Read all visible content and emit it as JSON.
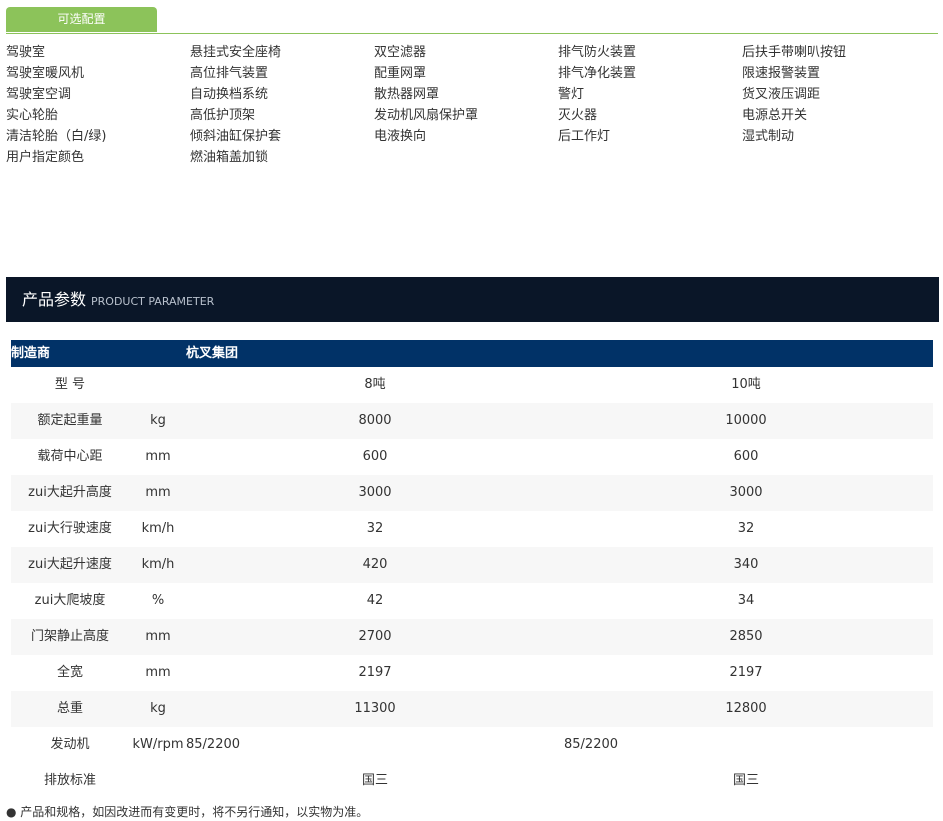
{
  "tab": {
    "label": "可选配置"
  },
  "options": {
    "columns": [
      [
        "驾驶室",
        "驾驶室暖风机",
        "驾驶室空调",
        "实心轮胎",
        "清洁轮胎（白/绿)",
        "用户指定颜色"
      ],
      [
        "悬挂式安全座椅",
        "高位排气装置",
        "自动换档系统",
        "高低护顶架",
        "倾斜油缸保护套",
        "燃油箱盖加锁"
      ],
      [
        "双空滤器",
        "配重网罩",
        "散热器网罩",
        "发动机风扇保护罩",
        "电液换向"
      ],
      [
        "排气防火装置",
        "排气净化装置",
        "警灯",
        "灭火器",
        "后工作灯"
      ],
      [
        "后扶手带喇叭按钮",
        "限速报警装置",
        "货叉液压调距",
        "电源总开关",
        "湿式制动"
      ]
    ]
  },
  "param_header": {
    "title": "产品参数",
    "subtitle": "PRODUCT PARAMETER"
  },
  "table": {
    "header": {
      "label": "制造商",
      "value": "杭叉集团"
    },
    "rows": [
      {
        "name": "型 号",
        "unit": "",
        "v1": "8吨",
        "v2": "10吨"
      },
      {
        "name": "额定起重量",
        "unit": "kg",
        "v1": "8000",
        "v2": "10000"
      },
      {
        "name": "载荷中心距",
        "unit": "mm",
        "v1": "600",
        "v2": "600"
      },
      {
        "name": "zui大起升高度",
        "unit": "mm",
        "v1": "3000",
        "v2": "3000"
      },
      {
        "name": "zui大行驶速度",
        "unit": "km/h",
        "v1": "32",
        "v2": "32"
      },
      {
        "name": "zui大起升速度",
        "unit": "km/h",
        "v1": "420",
        "v2": "340"
      },
      {
        "name": "zui大爬坡度",
        "unit": "%",
        "v1": "42",
        "v2": "34"
      },
      {
        "name": "门架静止高度",
        "unit": "mm",
        "v1": "2700",
        "v2": "2850"
      },
      {
        "name": "全宽",
        "unit": "mm",
        "v1": "2197",
        "v2": "2197"
      },
      {
        "name": "总重",
        "unit": "kg",
        "v1": "11300",
        "v2": "12800"
      }
    ],
    "engine": {
      "name": "发动机",
      "unit": "kW/rpm",
      "v1": "85/2200",
      "v2": "85/2200"
    },
    "emission": {
      "name": "排放标准",
      "v1": "国三",
      "v2": "国三"
    }
  },
  "note": "● 产品和规格，如因改进而有变更时，将不另行通知，以实物为准。",
  "colors": {
    "tab_green": "#8cc35a",
    "header_dark": "#0a1628",
    "table_head_blue": "#013267"
  }
}
